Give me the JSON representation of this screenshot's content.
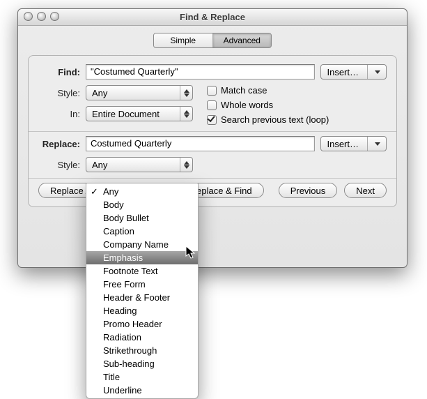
{
  "window": {
    "title": "Find & Replace"
  },
  "tabs": {
    "simple": "Simple",
    "advanced": "Advanced",
    "active": "advanced"
  },
  "labels": {
    "find": "Find:",
    "style_find": "Style:",
    "in": "In:",
    "replace": "Replace:",
    "style_replace": "Style:"
  },
  "find": {
    "value": "\"Costumed Quarterly\"",
    "style": "Any",
    "scope": "Entire Document",
    "insert_label": "Insert…"
  },
  "options": {
    "match_case": {
      "label": "Match case",
      "checked": false
    },
    "whole_words": {
      "label": "Whole words",
      "checked": false
    },
    "loop": {
      "label": "Search previous text (loop)",
      "checked": true
    }
  },
  "replace": {
    "value": "Costumed Quarterly",
    "style": "Any",
    "insert_label": "Insert…"
  },
  "buttons": {
    "replace_all": "Replace All",
    "replace": "Replace",
    "replace_find": "Replace & Find",
    "previous": "Previous",
    "next": "Next"
  },
  "style_menu": {
    "selected": "Any",
    "highlighted": "Emphasis",
    "items": [
      "Any",
      "Body",
      "Body Bullet",
      "Caption",
      "Company Name",
      "Emphasis",
      "Footnote Text",
      "Free Form",
      "Header & Footer",
      "Heading",
      "Promo Header",
      "Radiation",
      "Strikethrough",
      "Sub-heading",
      "Title",
      "Underline"
    ]
  }
}
